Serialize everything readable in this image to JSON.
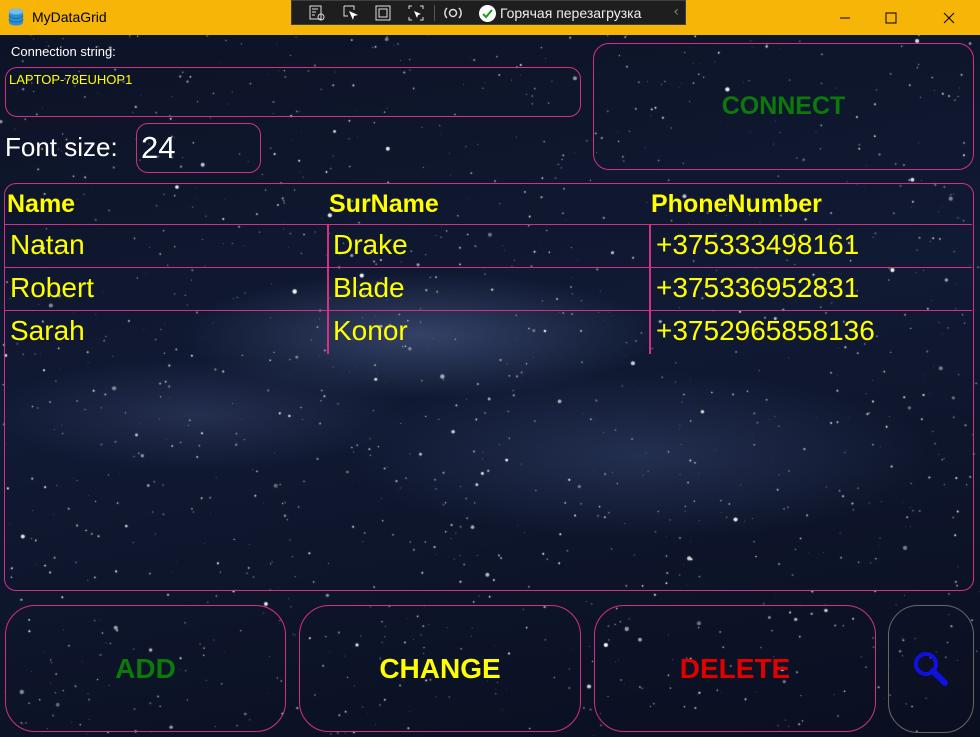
{
  "window": {
    "title": "MyDataGrid",
    "hot_reload_label": "Горячая перезагрузка"
  },
  "form": {
    "connection_label": "Connection string:",
    "connection_value": "LAPTOP-78EUHOP1",
    "connect_label": "CONNECT",
    "font_size_label": "Font size:",
    "font_size_value": "24"
  },
  "grid": {
    "columns": [
      "Name",
      "SurName",
      "PhoneNumber"
    ],
    "rows": [
      [
        "Natan",
        "Drake",
        "+375333498161"
      ],
      [
        "Robert",
        "Blade",
        "+375336952831"
      ],
      [
        "Sarah",
        "Konor",
        "+3752965858136"
      ]
    ]
  },
  "actions": {
    "add_label": "ADD",
    "change_label": "CHANGE",
    "delete_label": "DELETE",
    "search_icon": "magnifier-icon"
  },
  "colors": {
    "titlebar": "#f7b508",
    "border": "#d22f86",
    "text_yellow": "#ffff00",
    "connect_green": "#0b7a0b",
    "add_green": "#0b7a0b",
    "delete_red": "#e00000",
    "search_blue": "#1010e0"
  }
}
